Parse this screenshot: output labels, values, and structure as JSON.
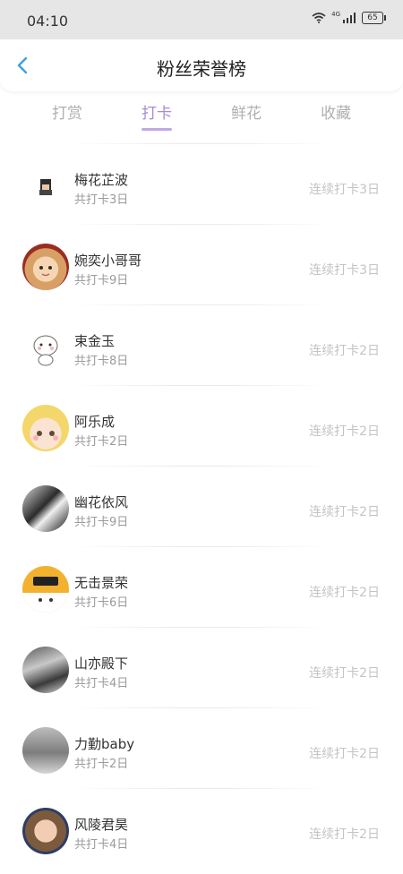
{
  "status_bar": {
    "time": "04:10",
    "network": "4G",
    "battery": "65"
  },
  "header": {
    "title": "粉丝荣誉榜"
  },
  "tabs": [
    {
      "label": "打赏"
    },
    {
      "label": "打卡"
    },
    {
      "label": "鲜花"
    },
    {
      "label": "收藏"
    }
  ],
  "active_tab": "打卡",
  "colors": {
    "accent": "#a78bd6",
    "back_icon": "#3aa1e4",
    "muted": "#c4c4c4"
  },
  "fans": [
    {
      "name": "梅花芷波",
      "total": "共打卡3日",
      "streak": "连续打卡3日"
    },
    {
      "name": "婉奕小哥哥",
      "total": "共打卡9日",
      "streak": "连续打卡3日"
    },
    {
      "name": "束金玉",
      "total": "共打卡8日",
      "streak": "连续打卡2日"
    },
    {
      "name": "阿乐成",
      "total": "共打卡2日",
      "streak": "连续打卡2日"
    },
    {
      "name": "幽花依风",
      "total": "共打卡9日",
      "streak": "连续打卡2日"
    },
    {
      "name": "无击景荣",
      "total": "共打卡6日",
      "streak": "连续打卡2日"
    },
    {
      "name": "山亦殿下",
      "total": "共打卡4日",
      "streak": "连续打卡2日"
    },
    {
      "name": "力勤baby",
      "total": "共打卡2日",
      "streak": "连续打卡2日"
    },
    {
      "name": "风陵君昊",
      "total": "共打卡4日",
      "streak": "连续打卡2日"
    }
  ]
}
